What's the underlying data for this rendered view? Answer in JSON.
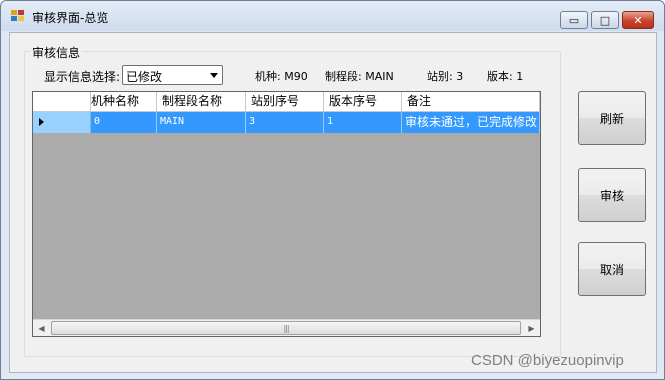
{
  "window": {
    "title": "审核界面-总览",
    "controls": {
      "minimize": "▭",
      "maximize": "□",
      "close": "✕"
    }
  },
  "group": {
    "title": "审核信息",
    "filter_label": "显示信息选择:",
    "filter_value": "已修改",
    "info": {
      "model": "机种: M90",
      "process": "制程段: MAIN",
      "station": "站别: 3",
      "version": "版本: 1"
    }
  },
  "grid": {
    "columns": [
      "机种名称",
      "制程段名称",
      "站别序号",
      "版本序号",
      "备注"
    ],
    "rows": [
      [
        "0",
        "MAIN",
        "3",
        "1",
        "审核未通过，已完成修改"
      ]
    ],
    "selection_color": "#3399ff"
  },
  "buttons": {
    "refresh": "刷新",
    "review": "审核",
    "cancel": "取消"
  },
  "watermark": "CSDN @biyezuopinvip"
}
